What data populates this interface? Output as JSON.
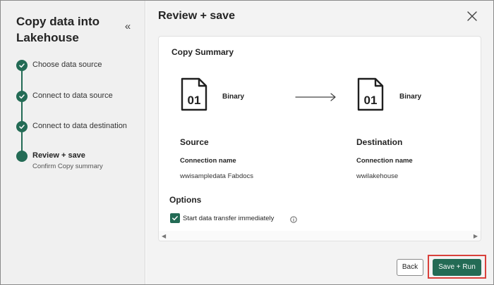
{
  "sidebar": {
    "title": "Copy data into Lakehouse",
    "collapse_icon": "chevron-double-left-icon",
    "steps": [
      {
        "label": "Choose data source",
        "status": "completed"
      },
      {
        "label": "Connect to data source",
        "status": "completed"
      },
      {
        "label": "Connect to data destination",
        "status": "completed"
      },
      {
        "label": "Review + save",
        "sublabel": "Confirm Copy summary",
        "status": "current"
      }
    ]
  },
  "main": {
    "title": "Review + save",
    "close_icon": "close-icon"
  },
  "summary": {
    "heading": "Copy Summary",
    "source": {
      "file_type": "Binary",
      "file_icon_text": "01",
      "section_title": "Source",
      "connection_label": "Connection name",
      "connection_value": "wwisampledata Fabdocs"
    },
    "destination": {
      "file_type": "Binary",
      "file_icon_text": "01",
      "section_title": "Destination",
      "connection_label": "Connection name",
      "connection_value": "wwilakehouse"
    }
  },
  "options": {
    "heading": "Options",
    "start_immediately_label": "Start data transfer immediately",
    "start_immediately_checked": true
  },
  "footer": {
    "back_label": "Back",
    "run_label": "Save + Run"
  },
  "colors": {
    "accent": "#236b55",
    "highlight": "#d9403b"
  }
}
